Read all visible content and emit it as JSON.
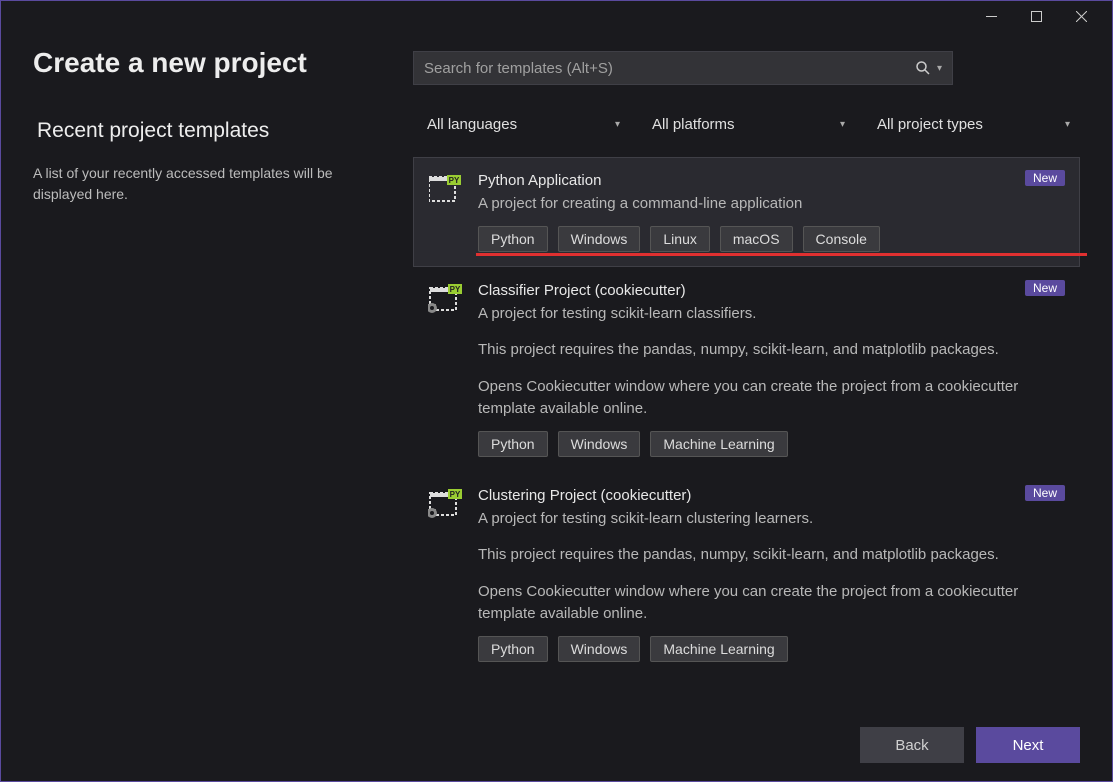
{
  "window": {
    "title": "Create a new project"
  },
  "recent": {
    "heading": "Recent project templates",
    "description": "A list of your recently accessed templates will be displayed here."
  },
  "search": {
    "placeholder": "Search for templates (Alt+S)"
  },
  "filters": {
    "language": "All languages",
    "platform": "All platforms",
    "projectType": "All project types"
  },
  "badges": {
    "new": "New"
  },
  "templates": [
    {
      "name": "Python Application",
      "description": "A project for creating a command-line application",
      "tags": [
        "Python",
        "Windows",
        "Linux",
        "macOS",
        "Console"
      ],
      "isNew": true,
      "selected": true,
      "highlightTags": true
    },
    {
      "name": "Classifier Project (cookiecutter)",
      "description": "A project for testing scikit-learn classifiers.",
      "extra1": "This project requires the pandas, numpy, scikit-learn, and matplotlib packages.",
      "extra2": "Opens Cookiecutter window where you can create the project from a cookiecutter template available online.",
      "tags": [
        "Python",
        "Windows",
        "Machine Learning"
      ],
      "isNew": true
    },
    {
      "name": "Clustering Project (cookiecutter)",
      "description": "A project for testing scikit-learn clustering learners.",
      "extra1": "This project requires the pandas, numpy, scikit-learn, and matplotlib packages.",
      "extra2": "Opens Cookiecutter window where you can create the project from a cookiecutter template available online.",
      "tags": [
        "Python",
        "Windows",
        "Machine Learning"
      ],
      "isNew": true
    }
  ],
  "buttons": {
    "back": "Back",
    "next": "Next"
  }
}
